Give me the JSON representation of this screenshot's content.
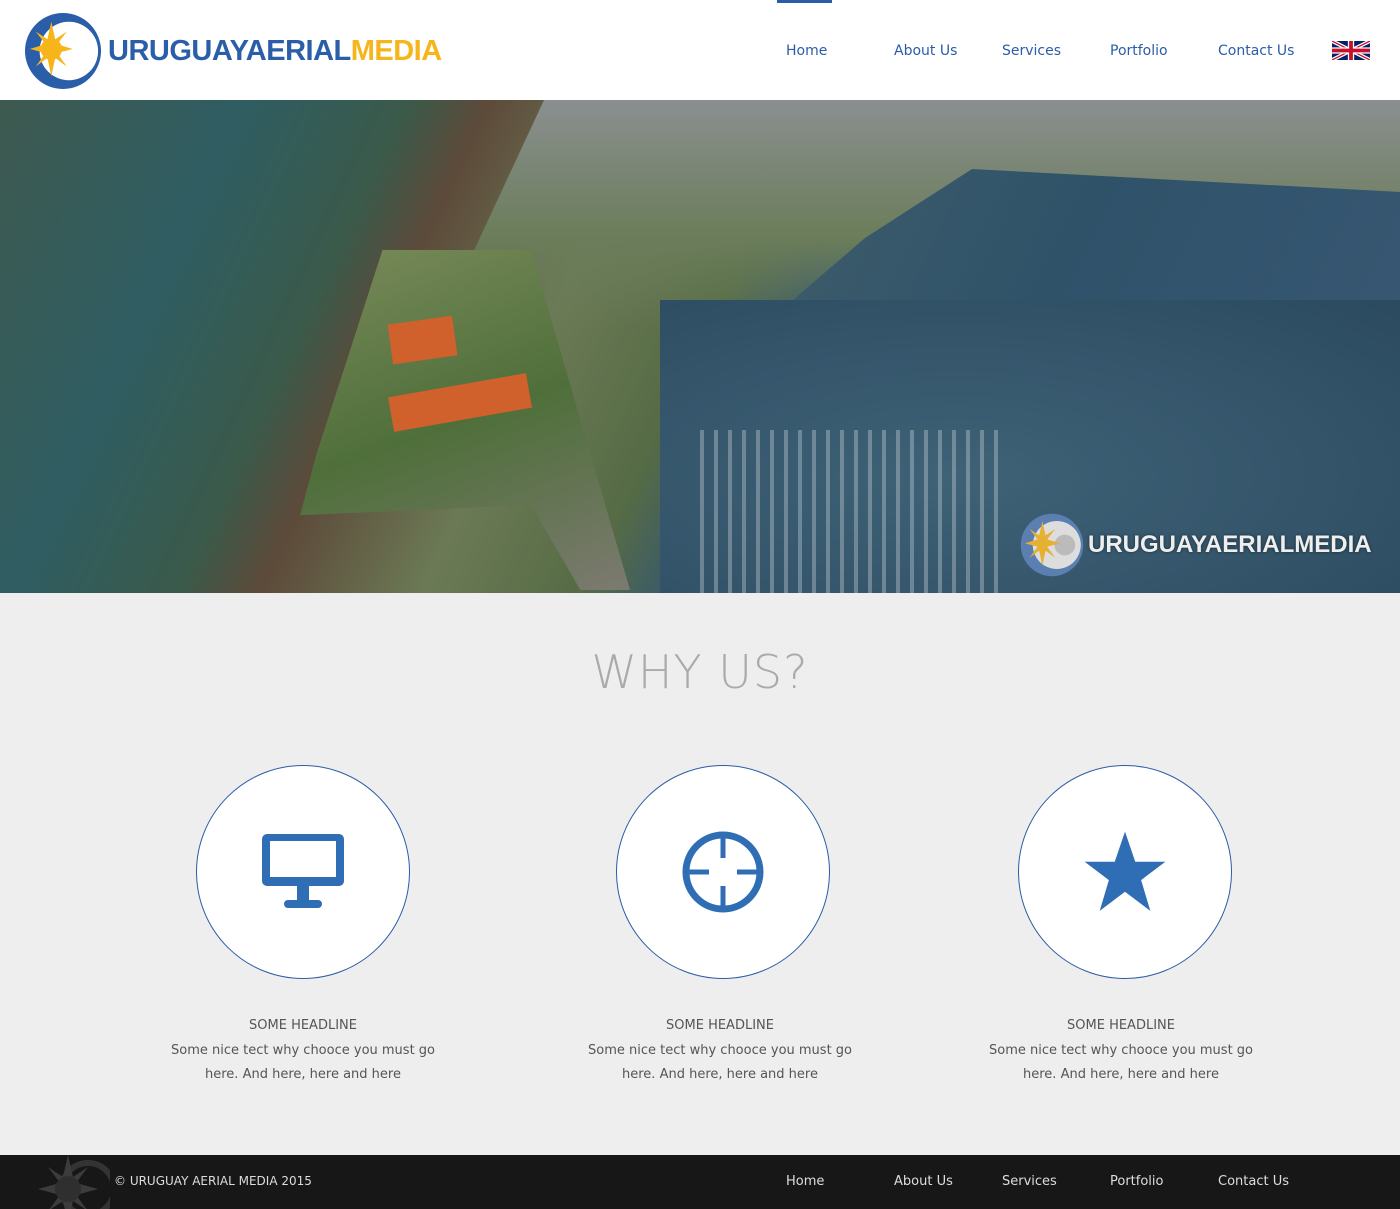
{
  "header": {
    "logo_text_primary": "URUGUAYAERIAL",
    "logo_text_accent": "MEDIA",
    "nav": [
      {
        "label": "Home",
        "active": true
      },
      {
        "label": "About Us"
      },
      {
        "label": "Services"
      },
      {
        "label": "Portfolio"
      },
      {
        "label": "Contact Us"
      }
    ],
    "language": "English (UK flag)"
  },
  "hero": {
    "watermark": "URUGUAYAERIALMEDIA"
  },
  "why": {
    "title": "WHY US?",
    "features": [
      {
        "icon": "monitor-icon",
        "headline": "SOME HEADLINE",
        "text": "Some nice tect why chooce you must go here. And here, here and here"
      },
      {
        "icon": "crosshair-icon",
        "headline": "SOME HEADLINE",
        "text": "Some nice tect why chooce you must go here. And here, here and here"
      },
      {
        "icon": "star-icon",
        "headline": "SOME HEADLINE",
        "text": "Some nice tect why chooce you must go here. And here, here and here"
      }
    ]
  },
  "footer": {
    "copyright": "© URUGUAY AERIAL MEDIA 2015",
    "nav": [
      {
        "label": "Home"
      },
      {
        "label": "About Us"
      },
      {
        "label": "Services"
      },
      {
        "label": "Portfolio"
      },
      {
        "label": "Contact Us"
      }
    ]
  },
  "colors": {
    "brand_blue": "#2b5ca8",
    "brand_yellow": "#f7b51c",
    "footer_bg": "#181718"
  }
}
